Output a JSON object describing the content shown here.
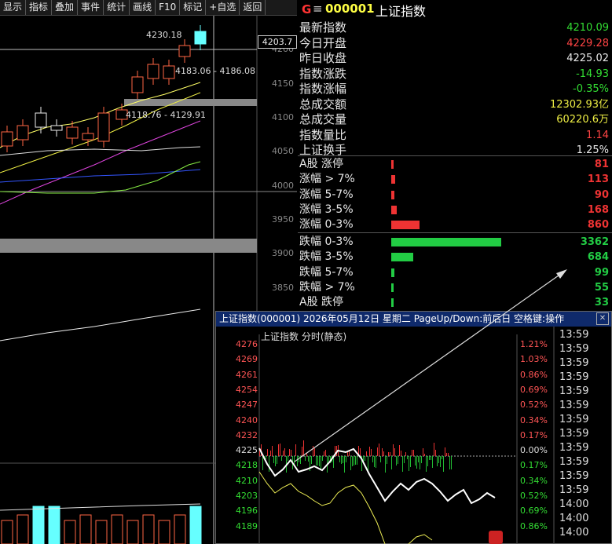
{
  "toolbar": {
    "items": [
      "显示",
      "指标",
      "叠加",
      "事件",
      "统计",
      "画线",
      "F10",
      "标记",
      "+自选",
      "返回"
    ]
  },
  "kchart": {
    "y_ticks": [
      "4200",
      "4150",
      "4100",
      "4050",
      "4000",
      "3950",
      "3900",
      "3850"
    ],
    "current_price_box": "4203.7",
    "hi_label": "4230.18",
    "range_label_1": "4183.06 - 4186.08",
    "range_label_2": "4118.76 - 4129.91"
  },
  "header": {
    "g_label": "G",
    "menu_icon": "≡",
    "code": "000001",
    "name": "上证指数"
  },
  "stats": [
    {
      "label": "最新指数",
      "value": "4210.09",
      "color": "#33dd33"
    },
    {
      "label": "今日开盘",
      "value": "4229.28",
      "color": "#ff4444"
    },
    {
      "label": "昨日收盘",
      "value": "4225.02",
      "color": "#e8e8e8"
    },
    {
      "label": "指数涨跌",
      "value": "-14.93",
      "color": "#33dd33"
    },
    {
      "label": "指数涨幅",
      "value": "-0.35%",
      "color": "#33dd33"
    },
    {
      "label": "总成交额",
      "value": "12302.93亿",
      "color": "#eeee44"
    },
    {
      "label": "总成交量",
      "value": "60220.6万",
      "color": "#eeee44"
    },
    {
      "label": "指数量比",
      "value": "1.14",
      "color": "#ff4444"
    },
    {
      "label": "上证换手",
      "value": "1.25%",
      "color": "#e8e8e8"
    }
  ],
  "distribution": [
    {
      "label": "A股 涨停",
      "value": "81",
      "color": "#ee3333",
      "count": 81
    },
    {
      "label": "涨幅 > 7%",
      "value": "113",
      "color": "#ee3333",
      "count": 113
    },
    {
      "label": "涨幅 5-7%",
      "value": "90",
      "color": "#ee3333",
      "count": 90
    },
    {
      "label": "涨幅 3-5%",
      "value": "168",
      "color": "#ee3333",
      "count": 168
    },
    {
      "label": "涨幅 0-3%",
      "value": "860",
      "color": "#ee3333",
      "count": 860
    },
    {
      "label": "跌幅 0-3%",
      "value": "3362",
      "color": "#22cc44",
      "count": 3362
    },
    {
      "label": "跌幅 3-5%",
      "value": "684",
      "color": "#22cc44",
      "count": 684
    },
    {
      "label": "跌幅 5-7%",
      "value": "99",
      "color": "#22cc44",
      "count": 99
    },
    {
      "label": "跌幅 > 7%",
      "value": "55",
      "color": "#22cc44",
      "count": 55
    },
    {
      "label": "A股 跌停",
      "value": "33",
      "color": "#22cc44",
      "count": 33
    }
  ],
  "popup": {
    "title": "上证指数(000001) 2026年05月12日 星期二 PageUp/Down:前后日 空格键:操作",
    "close": "✕",
    "subtitle": "上证指数  分时(静态)",
    "price_ticks": [
      "4276",
      "4269",
      "4261",
      "4254",
      "4247",
      "4240",
      "4232",
      "4225",
      "4218",
      "4210",
      "4203",
      "4196",
      "4189"
    ],
    "pct_ticks": [
      "1.21%",
      "1.03%",
      "0.86%",
      "0.69%",
      "0.52%",
      "0.34%",
      "0.17%",
      "0.00%",
      "0.17%",
      "0.34%",
      "0.52%",
      "0.69%",
      "0.86%"
    ],
    "times": [
      "13:59",
      "13:59",
      "13:59",
      "13:59",
      "13:59",
      "13:59",
      "13:59",
      "13:59",
      "13:59",
      "13:59",
      "13:59",
      "13:59",
      "14:00",
      "14:00",
      "14:00"
    ]
  }
}
